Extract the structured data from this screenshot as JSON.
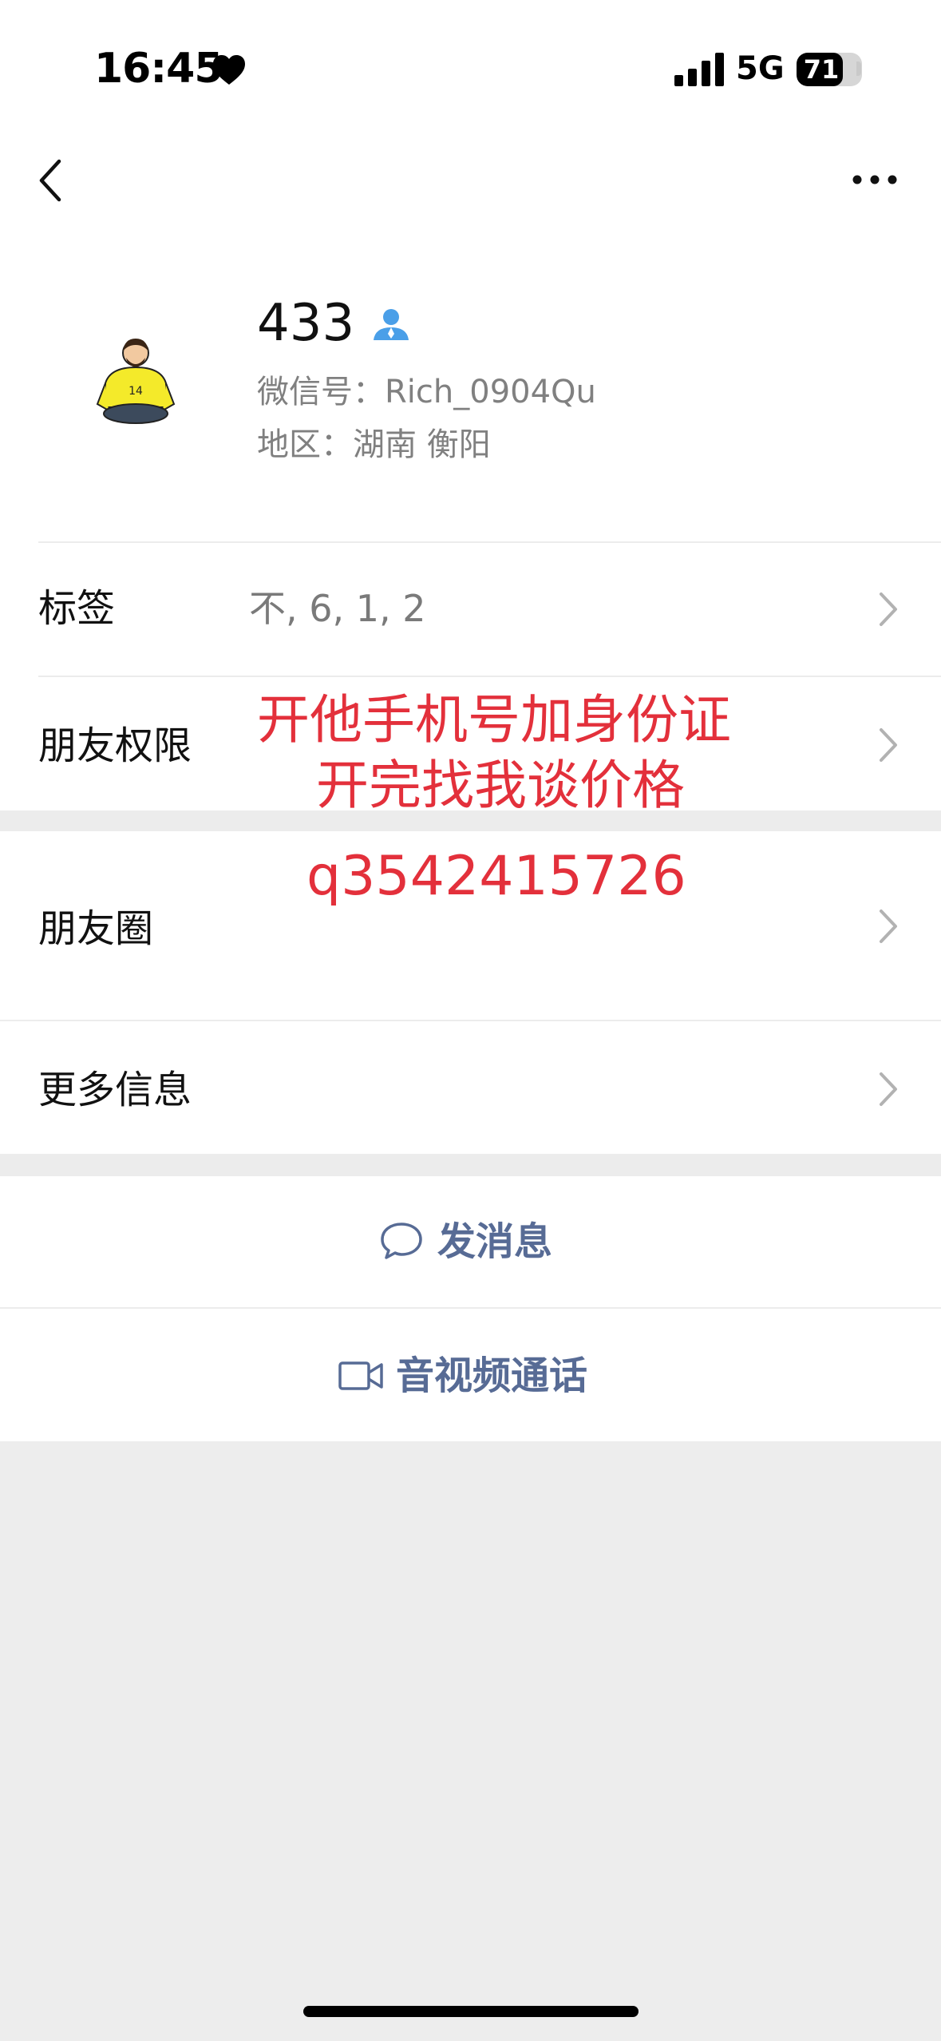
{
  "status_bar": {
    "time": "16:45",
    "network": "5G",
    "battery": "71",
    "battery_level": 0.71
  },
  "profile": {
    "nickname": "433",
    "wechat_id": "微信号：Rich_0904Qu",
    "region": "地区：湖南 衡阳"
  },
  "rows": {
    "tags_label": "标签",
    "tags_value": "不, 6, 1, 2",
    "permissions_label": "朋友权限",
    "moments_label": "朋友圈",
    "more_info_label": "更多信息"
  },
  "overlay": {
    "line1": "开他手机号加身份证",
    "line2": "开完找我谈价格",
    "contact": "q3542415726",
    "color": "#e3303b"
  },
  "actions": {
    "message": "发消息",
    "call": "音视频通话",
    "accent_color": "#576b95"
  },
  "icons": [
    "heart-icon",
    "signal-icon",
    "back-icon",
    "more-icon",
    "person-badge-icon",
    "chevron-right-icon",
    "chat-bubble-icon",
    "video-camera-icon"
  ]
}
